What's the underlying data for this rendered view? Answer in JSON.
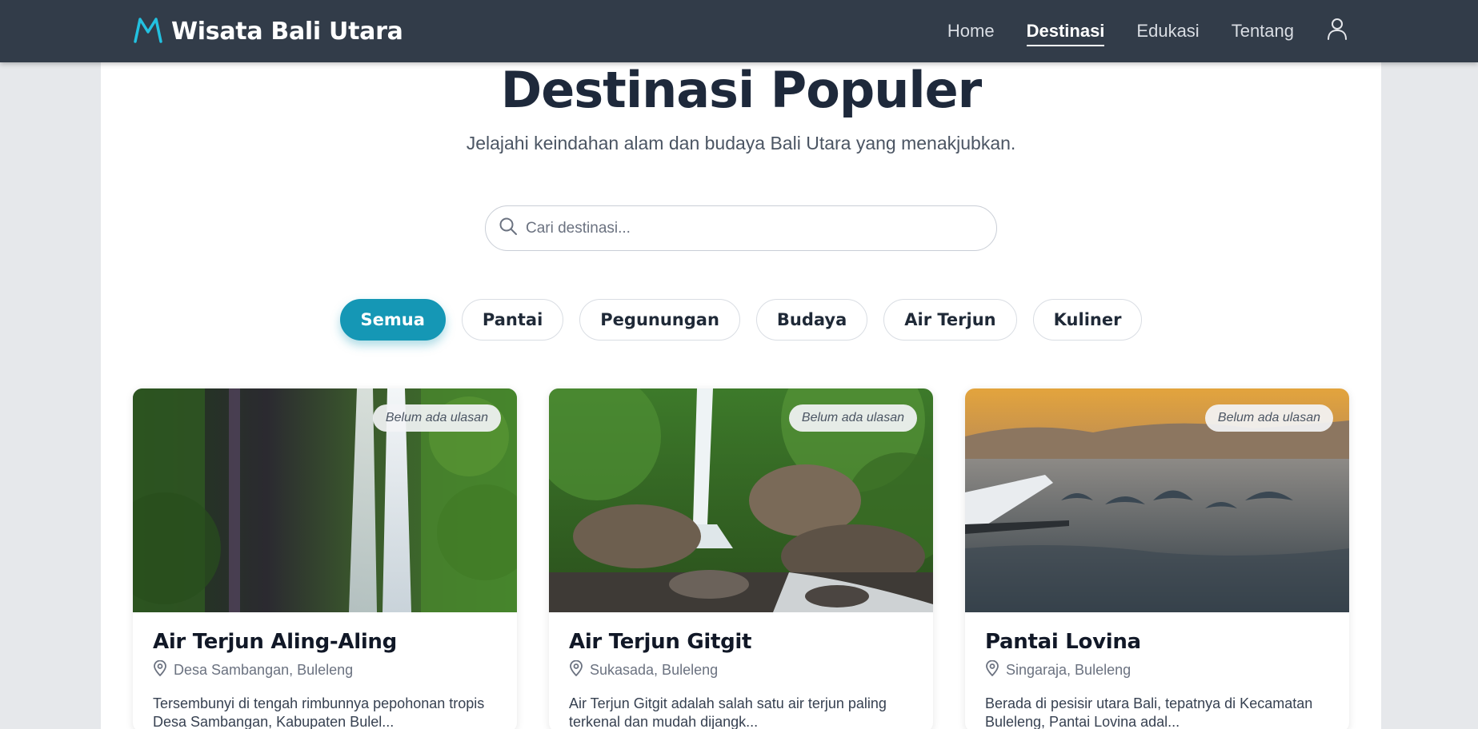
{
  "brand": {
    "title": "Wisata Bali Utara",
    "accent": "#22c1e0"
  },
  "nav": {
    "links": [
      {
        "label": "Home"
      },
      {
        "label": "Destinasi"
      },
      {
        "label": "Edukasi"
      },
      {
        "label": "Tentang"
      }
    ],
    "active": "Destinasi"
  },
  "page": {
    "title": "Destinasi Populer",
    "subtitle": "Jelajahi keindahan alam dan budaya Bali Utara yang menakjubkan."
  },
  "search": {
    "placeholder": "Cari destinasi...",
    "value": ""
  },
  "filters": {
    "items": [
      {
        "label": "Semua"
      },
      {
        "label": "Pantai"
      },
      {
        "label": "Pegunungan"
      },
      {
        "label": "Budaya"
      },
      {
        "label": "Air Terjun"
      },
      {
        "label": "Kuliner"
      }
    ],
    "active": "Semua",
    "active_color": "#1597b5"
  },
  "cards": [
    {
      "badge": "Belum ada ulasan",
      "title": "Air Terjun Aling-Aling",
      "location": "Desa Sambangan, Buleleng",
      "description": "Tersembunyi di tengah rimbunnya pepohonan tropis Desa Sambangan, Kabupaten Bulel..."
    },
    {
      "badge": "Belum ada ulasan",
      "title": "Air Terjun Gitgit",
      "location": "Sukasada, Buleleng",
      "description": "Air Terjun Gitgit adalah salah satu air terjun paling terkenal dan mudah dijangk..."
    },
    {
      "badge": "Belum ada ulasan",
      "title": "Pantai Lovina",
      "location": "Singaraja, Buleleng",
      "description": "Berada di pesisir utara Bali, tepatnya di Kecamatan Buleleng, Pantai Lovina adal..."
    }
  ]
}
